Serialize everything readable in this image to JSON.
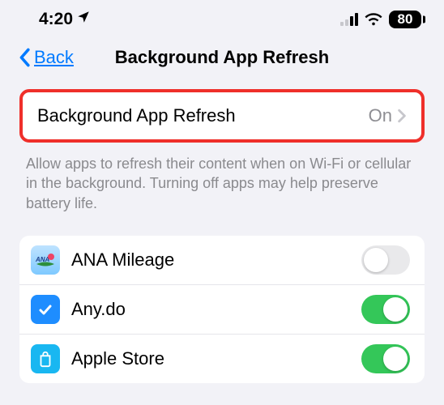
{
  "statusbar": {
    "time": "4:20",
    "battery": "80"
  },
  "nav": {
    "back": "Back",
    "title": "Background App Refresh"
  },
  "master": {
    "label": "Background App Refresh",
    "value": "On"
  },
  "footer": "Allow apps to refresh their content when on Wi-Fi or cellular in the background. Turning off apps may help preserve battery life.",
  "apps": [
    {
      "name": "ANA Mileage",
      "on": false
    },
    {
      "name": "Any.do",
      "on": true
    },
    {
      "name": "Apple Store",
      "on": true
    }
  ]
}
